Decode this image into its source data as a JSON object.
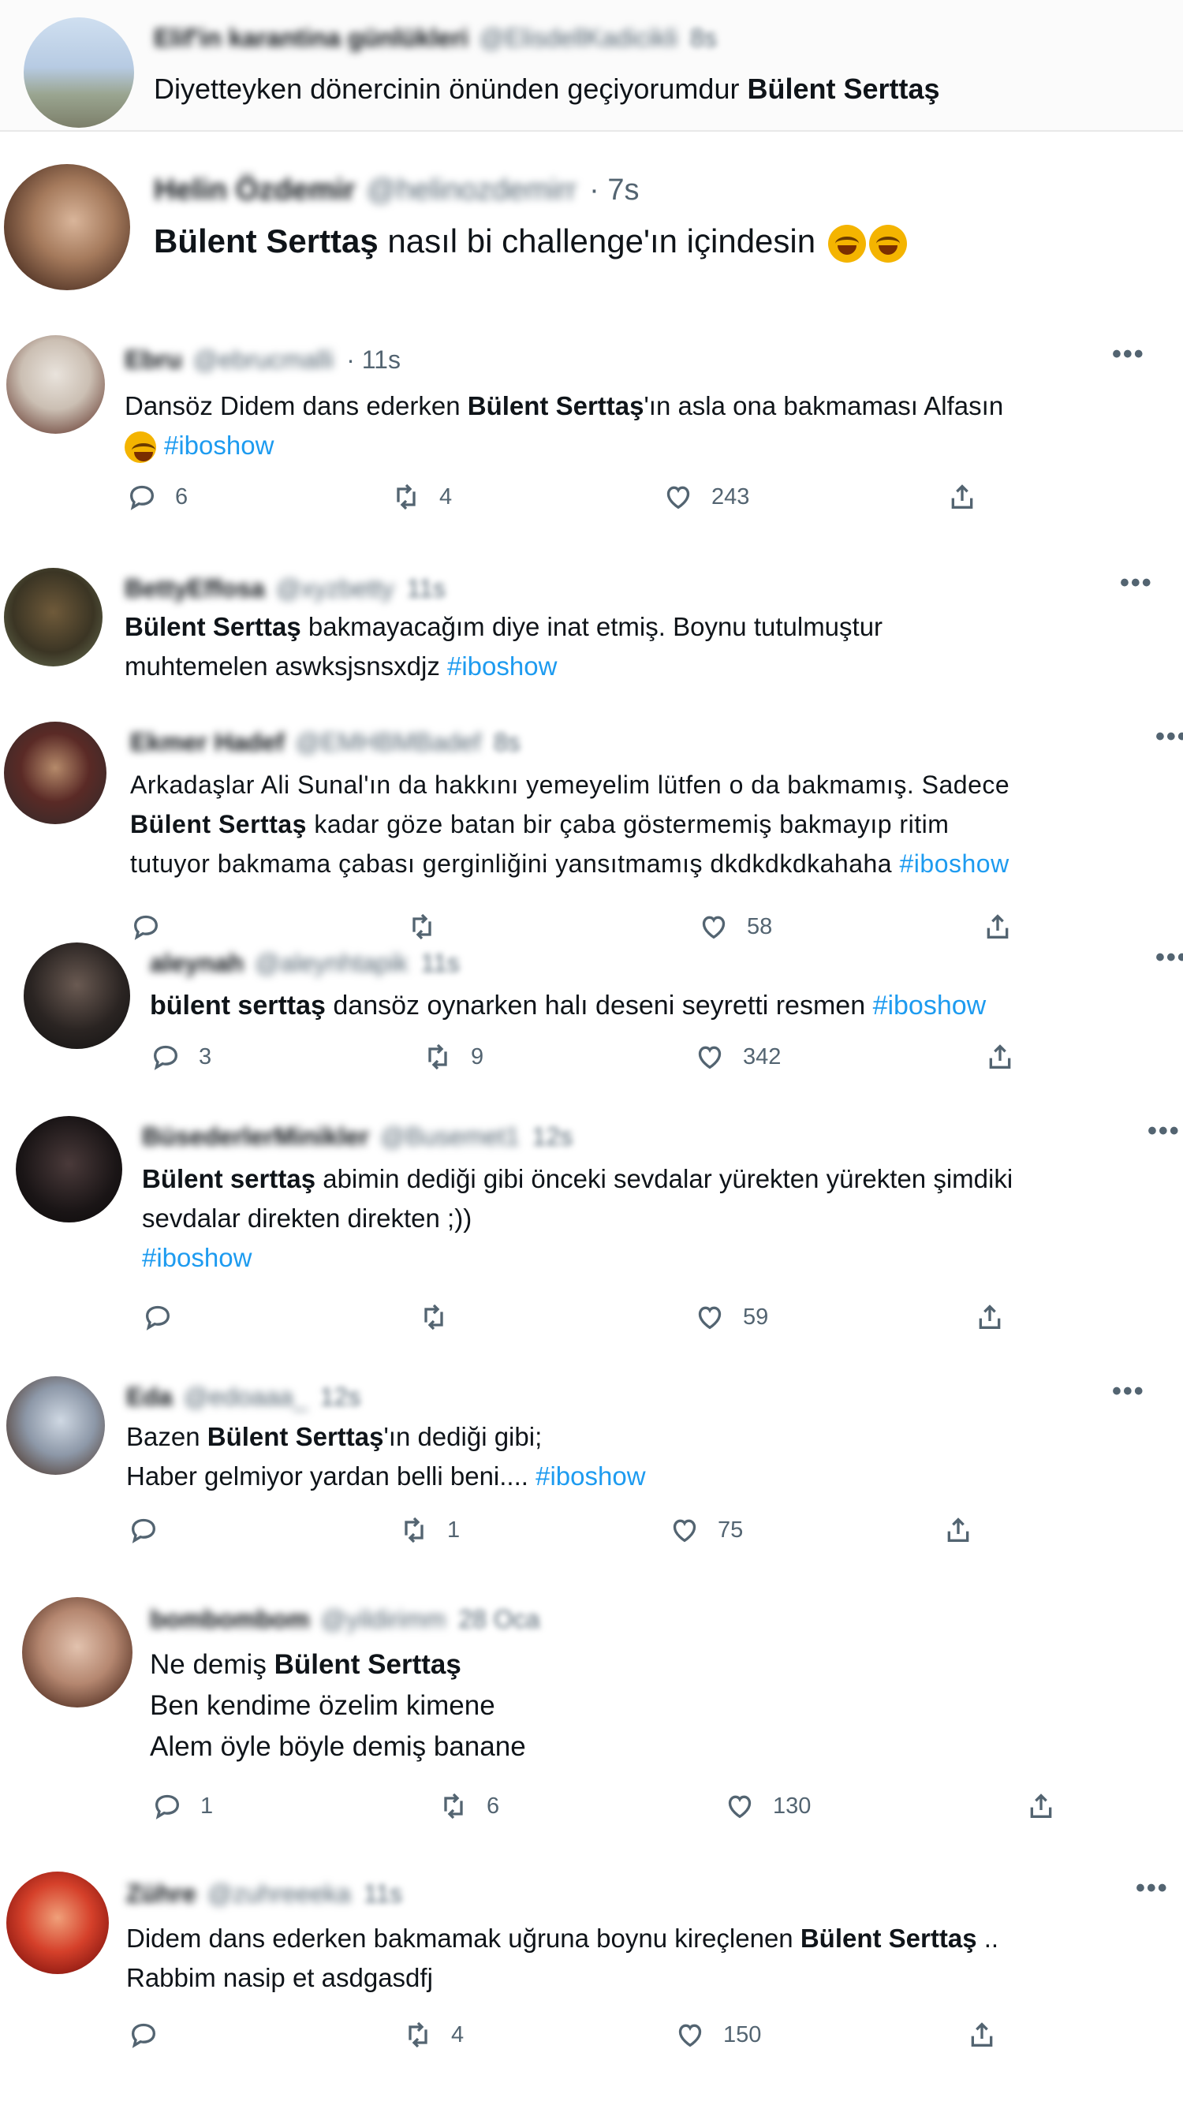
{
  "quoted": {
    "name": "Elif'in karantina günlükleri",
    "handle": "@ElisdellKadicikli",
    "time": "8s",
    "text": "Diyetteyken dönercinin önünden geçiyorumdur",
    "text_bold": "Bülent Serttaş"
  },
  "tweets": [
    {
      "name": "Helin Özdemir",
      "handle": "@helinozdemirr",
      "time": "· 7s",
      "bold_lead": "Bülent Serttaş",
      "text": " nasıl bi challenge'ın içindesin"
    },
    {
      "name": "Ebru",
      "handle": "@ebrucmalli",
      "time": "· 11s",
      "line1_pre": "Dansöz Didem dans ederken ",
      "line1_bold": "Bülent Serttaş",
      "line1_post": "'ın asla ona bakmaması Alfasın",
      "line2_tag": "#iboshow",
      "replies": "6",
      "retweets": "4",
      "likes": "243"
    },
    {
      "name": "BettyEffosa",
      "handle": "@xyzbetty",
      "time": "11s",
      "line1_bold": "Bülent Serttaş",
      "line1_post": " bakmayacağım diye inat etmiş. Boynu tutulmuştur",
      "line2": "muhtemelen aswksjsnsxdjz ",
      "line2_tag": "#iboshow"
    },
    {
      "name": "Ekmer Hadef",
      "handle": "@EMHBMBadef",
      "time": "8s",
      "line1": "Arkadaşlar Ali Sunal'ın da hakkını yemeyelim lütfen o da bakmamış. Sadece",
      "line2_bold": "Bülent Serttaş",
      "line2_post": " kadar göze batan bir çaba göstermemiş bakmayıp ritim",
      "line3": "tutuyor bakmama çabası gerginliğini yansıtmamış dkdkdkdkahaha ",
      "line3_tag": "#iboshow",
      "likes": "58"
    },
    {
      "name": "aleynah",
      "handle": "@aleynhtapik",
      "time": "11s",
      "line1_bold": "bülent serttaş",
      "line1_post": " dansöz oynarken halı deseni seyretti resmen ",
      "line1_tag": "#iboshow",
      "replies": "3",
      "retweets": "9",
      "likes": "342"
    },
    {
      "name": "BüsederlerMinikler",
      "handle": "@Busemet1",
      "time": "12s",
      "line1_bold": "Bülent serttaş",
      "line1_post": " abimin dediği gibi önceki sevdalar yürekten yürekten şimdiki",
      "line2": "sevdalar direkten direkten ;))",
      "line3_tag": "#iboshow",
      "likes": "59"
    },
    {
      "name": "Eda",
      "handle": "@edoaaa_",
      "time": "12s",
      "line1_pre": "Bazen ",
      "line1_bold": "Bülent Serttaş",
      "line1_post": "'ın dediği gibi;",
      "line2": "Haber gelmiyor yardan belli beni.... ",
      "line2_tag": "#iboshow",
      "retweets": "1",
      "likes": "75"
    },
    {
      "name": "bombombom",
      "handle": "@yildirimm",
      "time": "28 Oca",
      "line1_pre": "Ne demiş ",
      "line1_bold": "Bülent Serttaş",
      "line2": "Ben kendime özelim kimene",
      "line3": "Alem öyle böyle demiş banane",
      "replies": "1",
      "retweets": "6",
      "likes": "130"
    },
    {
      "name": "Zühre",
      "handle": "@zuhreeeka",
      "time": "11s",
      "line1_pre": "Didem dans ederken bakmamak uğruna boynu kireçlenen ",
      "line1_bold": "Bülent Serttaş",
      "line1_post": " ..",
      "line2": "Rabbim nasip et asdgasdfj",
      "retweets": "4",
      "likes": "150"
    }
  ],
  "icons": {
    "more": "more-dots-icon",
    "reply": "reply-icon",
    "retweet": "retweet-icon",
    "like": "heart-icon",
    "share": "share-icon",
    "emoji": "laughing-tears-emoji"
  },
  "colors": {
    "hashtag": "#1d9bf0",
    "muted": "#536471",
    "text": "#0f1419"
  }
}
